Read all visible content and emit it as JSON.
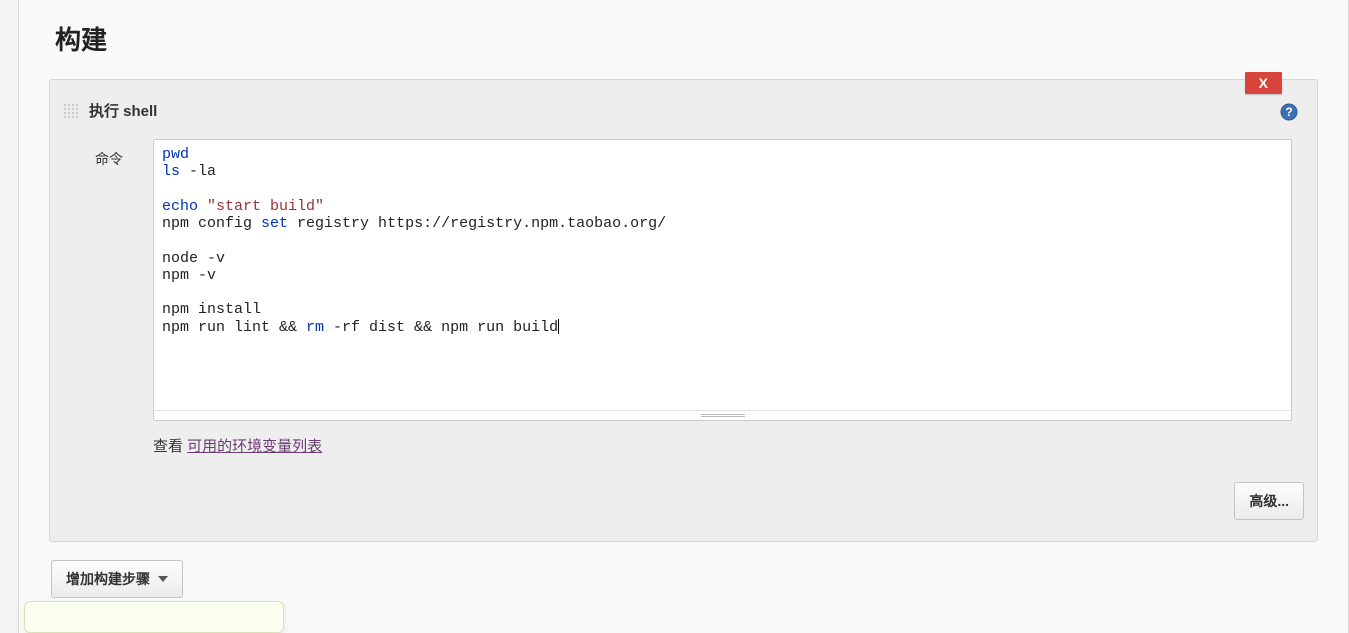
{
  "section": {
    "heading": "构建"
  },
  "buildStep": {
    "deleteLabel": "X",
    "title": "执行 shell",
    "commandLabel": "命令",
    "code": {
      "lines": [
        [
          {
            "t": "cmd",
            "v": "pwd"
          }
        ],
        [
          {
            "t": "cmd",
            "v": "ls"
          },
          {
            "t": "plain",
            "v": " -la"
          }
        ],
        [],
        [
          {
            "t": "cmd",
            "v": "echo"
          },
          {
            "t": "plain",
            "v": " "
          },
          {
            "t": "str",
            "v": "\"start build\""
          }
        ],
        [
          {
            "t": "plain",
            "v": "npm config "
          },
          {
            "t": "cmd",
            "v": "set"
          },
          {
            "t": "plain",
            "v": " registry https://registry.npm.taobao.org/"
          }
        ],
        [],
        [
          {
            "t": "plain",
            "v": "node -v"
          }
        ],
        [
          {
            "t": "plain",
            "v": "npm -v"
          }
        ],
        [],
        [
          {
            "t": "plain",
            "v": "npm install"
          }
        ],
        [
          {
            "t": "plain",
            "v": "npm run lint && "
          },
          {
            "t": "cmd",
            "v": "rm"
          },
          {
            "t": "plain",
            "v": " -rf dist && npm run build"
          }
        ]
      ]
    },
    "hint": {
      "prefix": "查看 ",
      "link": "可用的环境变量列表"
    },
    "advancedLabel": "高级..."
  },
  "addStepLabel": "增加构建步骤"
}
